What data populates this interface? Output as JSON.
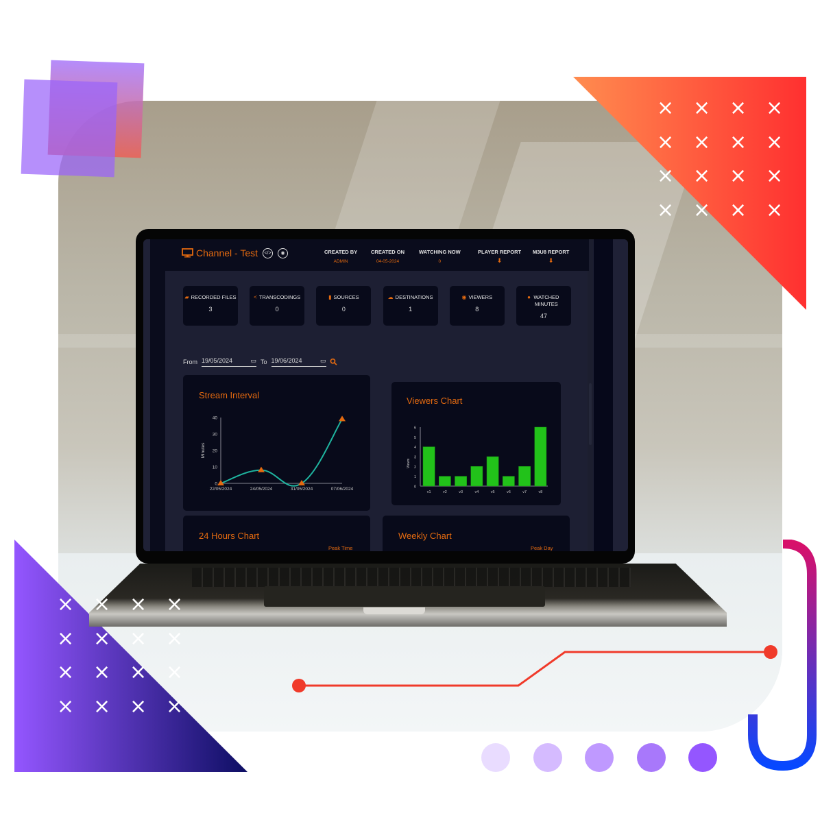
{
  "decor": {
    "x_mark": "×",
    "dot_colors": [
      "#e9dcff",
      "#d5bbff",
      "#bf99ff",
      "#a878fb",
      "#9456ff"
    ],
    "accent_red": "#f03a2a"
  },
  "app": {
    "title": "Channel - Test",
    "title_icon": "monitor-icon",
    "embed_icon": "</>",
    "preview_icon": "◉",
    "header": [
      {
        "label": "CREATED BY",
        "value": "ADMIN"
      },
      {
        "label": "CREATED ON",
        "value": "04-05-2024"
      },
      {
        "label": "WATCHING NOW",
        "value": "0"
      },
      {
        "label": "PLAYER REPORT",
        "value": "⬇"
      },
      {
        "label": "M3U8 REPORT",
        "value": "⬇"
      }
    ],
    "stats": [
      {
        "icon": "▰",
        "icon_name": "folder-icon",
        "label": "RECORDED FILES",
        "value": "3"
      },
      {
        "icon": "<",
        "icon_name": "share-icon",
        "label": "TRANSCODINGS",
        "value": "0"
      },
      {
        "icon": "▮",
        "icon_name": "file-icon",
        "label": "SOURCES",
        "value": "0"
      },
      {
        "icon": "☁",
        "icon_name": "cloud-icon",
        "label": "DESTINATIONS",
        "value": "1"
      },
      {
        "icon": "◉",
        "icon_name": "eye-icon",
        "label": "VIEWERS",
        "value": "8"
      },
      {
        "icon": "●",
        "icon_name": "clock-icon",
        "label": "WATCHED MINUTES",
        "value": "47"
      }
    ],
    "filter": {
      "from_label": "From",
      "from_value": "19/05/2024",
      "to_label": "To",
      "to_value": "19/06/2024",
      "calendar_icon": "▭",
      "search_icon": "⚲"
    },
    "panels": {
      "hours_title": "24 Hours Chart",
      "hours_peak": "Peak Time",
      "weekly_title": "Weekly Chart",
      "weekly_peak": "Peak Day"
    },
    "colors": {
      "accent": "#e46a10",
      "line": "#1fb5a0",
      "bar": "#22c21a",
      "bg": "#1d1f33",
      "panel": "#080a1a"
    }
  },
  "chart_data": [
    {
      "type": "line",
      "title": "Stream Interval",
      "xlabel": "",
      "ylabel": "Minutes",
      "categories": [
        "22/05/2024",
        "24/05/2024",
        "31/05/2024",
        "07/06/2024"
      ],
      "values": [
        0,
        8,
        0,
        39
      ],
      "ylim": [
        0,
        40
      ],
      "yticks": [
        0,
        10,
        20,
        30,
        40
      ],
      "grid": false,
      "marker": "triangle"
    },
    {
      "type": "bar",
      "title": "Viewers Chart",
      "xlabel": "",
      "ylabel": "Views",
      "categories": [
        "v1",
        "v2",
        "v3",
        "v4",
        "v5",
        "v6",
        "v7",
        "v8"
      ],
      "values": [
        4,
        1,
        1,
        2,
        3,
        1,
        2,
        6
      ],
      "ylim": [
        0,
        6
      ],
      "yticks": [
        0,
        1,
        2,
        3,
        4,
        5,
        6
      ],
      "grid": false
    }
  ]
}
